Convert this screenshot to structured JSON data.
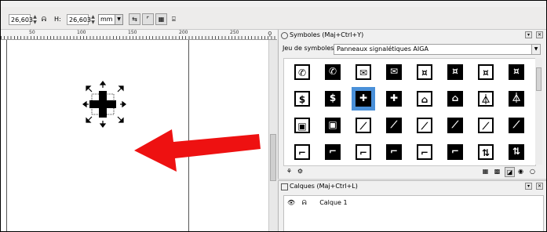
{
  "toolbar": {
    "x_value": "26,603",
    "h_label": "H:",
    "h_value": "26,603",
    "unit": "mm"
  },
  "ruler": {
    "labels": [
      "50",
      "100",
      "150",
      "200",
      "250"
    ]
  },
  "symbols_panel": {
    "title": "Symboles (Maj+Ctrl+Y)",
    "set_label": "Jeu de symboles :",
    "set_value": "Panneaux signalétiques AIGA"
  },
  "layers_panel": {
    "title": "Calques (Maj+Ctrl+L)",
    "layer_name": "Calque 1"
  },
  "symbol_grid": {
    "selected_index": 10,
    "icons": [
      "telephone-icon",
      "telephone-icon",
      "mail-icon",
      "mail-icon",
      "currency-exchange-icon",
      "currency-exchange-icon",
      "currency-exchange-icon",
      "currency-exchange-icon",
      "dollar-icon",
      "dollar-icon",
      "first-aid-icon",
      "first-aid-icon",
      "coat-check-icon",
      "coat-check-icon",
      "hanger-icon",
      "hanger-icon",
      "baggage-lockers-icon",
      "baggage-lockers-icon",
      "escalator-icon",
      "escalator-icon",
      "escalator-down-icon",
      "escalator-down-icon",
      "escalator-up-icon",
      "escalator-up-icon",
      "stairs-icon",
      "stairs-icon",
      "stairs-down-icon",
      "stairs-down-icon",
      "stairs-up-icon",
      "stairs-up-icon",
      "elevator-icon",
      "elevator-icon"
    ]
  },
  "colors": {
    "selection": "#4a90d9",
    "arrow": "#ee1111"
  }
}
